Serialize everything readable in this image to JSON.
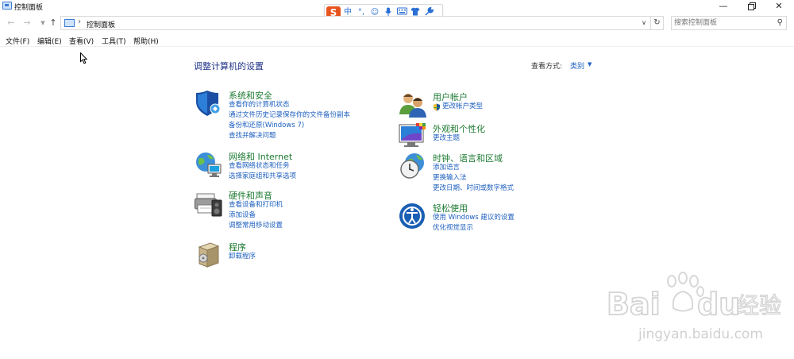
{
  "window": {
    "title": "控制面板"
  },
  "ime": {
    "logo": "S",
    "items": [
      "中",
      "°,",
      "☺",
      "🎤",
      "⌨",
      "👕",
      "🔧"
    ]
  },
  "address": {
    "path": "控制面板",
    "separator": "›"
  },
  "search": {
    "placeholder": "搜索控制面板"
  },
  "menu": {
    "items": [
      "文件(F)",
      "编辑(E)",
      "查看(V)",
      "工具(T)",
      "帮助(H)"
    ]
  },
  "header": {
    "title": "调整计算机的设置",
    "view_by_label": "查看方式:",
    "view_by_value": "类别"
  },
  "categories": [
    {
      "title": "系统和安全",
      "icon": "shield-icon",
      "links": [
        "查看你的计算机状态",
        "通过文件历史记录保存你的文件备份副本",
        "备份和还原(Windows 7)",
        "查找并解决问题"
      ]
    },
    {
      "title": "网络和 Internet",
      "icon": "network-globe-icon",
      "links": [
        "查看网络状态和任务",
        "选择家庭组和共享选项"
      ]
    },
    {
      "title": "硬件和声音",
      "icon": "printer-speaker-icon",
      "links": [
        "查看设备和打印机",
        "添加设备",
        "调整常用移动设置"
      ]
    },
    {
      "title": "程序",
      "icon": "programs-box-icon",
      "links": [
        "卸载程序"
      ]
    },
    {
      "title": "用户帐户",
      "icon": "users-icon",
      "links": [
        "更改帐户类型"
      ]
    },
    {
      "title": "外观和个性化",
      "icon": "display-palette-icon",
      "links": [
        "更改主题"
      ]
    },
    {
      "title": "时钟、语言和区域",
      "icon": "clock-globe-icon",
      "links": [
        "添加语言",
        "更换输入法",
        "更改日期、时间或数字格式"
      ]
    },
    {
      "title": "轻松使用",
      "icon": "accessibility-icon",
      "links": [
        "使用 Windows 建议的设置",
        "优化视觉显示"
      ]
    }
  ],
  "watermark": {
    "brand": "Bai",
    "brand2": "du",
    "chinese": "经验",
    "url": "jingyan.baidu.com"
  },
  "colors": {
    "link": "#1d5fbf",
    "category_title": "#1c7a32",
    "page_title": "#1e3287",
    "ime_logo": "#e8541e"
  }
}
